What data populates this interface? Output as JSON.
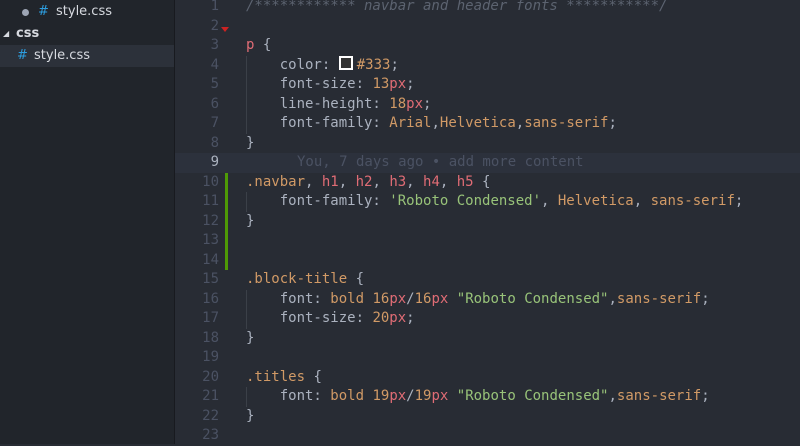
{
  "sidebar": {
    "open_file": "style.css",
    "folder": "css",
    "folder_file": "style.css",
    "hash": "#"
  },
  "editor": {
    "blame": "You, 7 days ago • add more content",
    "lines": [
      {
        "n": "1",
        "tokens": [
          [
            "c-comment",
            "/************ navbar and header fonts ***********/"
          ]
        ]
      },
      {
        "n": "2",
        "tokens": []
      },
      {
        "n": "3",
        "tokens": [
          [
            "c-tag",
            "p"
          ],
          [
            "c-punc",
            " {"
          ]
        ]
      },
      {
        "n": "4",
        "tokens": [
          [
            "c-prop",
            "    color: "
          ],
          [
            "swatch",
            ""
          ],
          [
            "c-num",
            "#333"
          ],
          [
            "c-punc",
            ";"
          ]
        ]
      },
      {
        "n": "5",
        "tokens": [
          [
            "c-prop",
            "    font-size: "
          ],
          [
            "c-num",
            "13"
          ],
          [
            "c-unit",
            "px"
          ],
          [
            "c-punc",
            ";"
          ]
        ]
      },
      {
        "n": "6",
        "tokens": [
          [
            "c-prop",
            "    line-height: "
          ],
          [
            "c-num",
            "18"
          ],
          [
            "c-unit",
            "px"
          ],
          [
            "c-punc",
            ";"
          ]
        ]
      },
      {
        "n": "7",
        "tokens": [
          [
            "c-prop",
            "    font-family: "
          ],
          [
            "c-val",
            "Arial"
          ],
          [
            "c-punc",
            ","
          ],
          [
            "c-val",
            "Helvetica"
          ],
          [
            "c-punc",
            ","
          ],
          [
            "c-val",
            "sans-serif"
          ],
          [
            "c-punc",
            ";"
          ]
        ]
      },
      {
        "n": "8",
        "tokens": [
          [
            "c-punc",
            "}"
          ]
        ]
      },
      {
        "n": "9",
        "tokens": []
      },
      {
        "n": "10",
        "tokens": [
          [
            "c-sel",
            ".navbar"
          ],
          [
            "c-punc",
            ", "
          ],
          [
            "c-tag",
            "h1"
          ],
          [
            "c-punc",
            ", "
          ],
          [
            "c-tag",
            "h2"
          ],
          [
            "c-punc",
            ", "
          ],
          [
            "c-tag",
            "h3"
          ],
          [
            "c-punc",
            ", "
          ],
          [
            "c-tag",
            "h4"
          ],
          [
            "c-punc",
            ", "
          ],
          [
            "c-tag",
            "h5"
          ],
          [
            "c-punc",
            " {"
          ]
        ]
      },
      {
        "n": "11",
        "tokens": [
          [
            "c-prop",
            "    font-family: "
          ],
          [
            "c-str",
            "'Roboto Condensed'"
          ],
          [
            "c-punc",
            ", "
          ],
          [
            "c-val",
            "Helvetica"
          ],
          [
            "c-punc",
            ", "
          ],
          [
            "c-val",
            "sans-serif"
          ],
          [
            "c-punc",
            ";"
          ]
        ]
      },
      {
        "n": "12",
        "tokens": [
          [
            "c-punc",
            "}"
          ]
        ]
      },
      {
        "n": "13",
        "tokens": []
      },
      {
        "n": "14",
        "tokens": []
      },
      {
        "n": "15",
        "tokens": [
          [
            "c-sel",
            ".block-title"
          ],
          [
            "c-punc",
            " {"
          ]
        ]
      },
      {
        "n": "16",
        "tokens": [
          [
            "c-prop",
            "    font: "
          ],
          [
            "c-val",
            "bold "
          ],
          [
            "c-num",
            "16"
          ],
          [
            "c-unit",
            "px"
          ],
          [
            "c-punc",
            "/"
          ],
          [
            "c-num",
            "16"
          ],
          [
            "c-unit",
            "px"
          ],
          [
            "c-punc",
            " "
          ],
          [
            "c-str",
            "\"Roboto Condensed\""
          ],
          [
            "c-punc",
            ","
          ],
          [
            "c-val",
            "sans-serif"
          ],
          [
            "c-punc",
            ";"
          ]
        ]
      },
      {
        "n": "17",
        "tokens": [
          [
            "c-prop",
            "    font-size: "
          ],
          [
            "c-num",
            "20"
          ],
          [
            "c-unit",
            "px"
          ],
          [
            "c-punc",
            ";"
          ]
        ]
      },
      {
        "n": "18",
        "tokens": [
          [
            "c-punc",
            "}"
          ]
        ]
      },
      {
        "n": "19",
        "tokens": []
      },
      {
        "n": "20",
        "tokens": [
          [
            "c-sel",
            ".titles"
          ],
          [
            "c-punc",
            " {"
          ]
        ]
      },
      {
        "n": "21",
        "tokens": [
          [
            "c-prop",
            "    font: "
          ],
          [
            "c-val",
            "bold "
          ],
          [
            "c-num",
            "19"
          ],
          [
            "c-unit",
            "px"
          ],
          [
            "c-punc",
            "/"
          ],
          [
            "c-num",
            "19"
          ],
          [
            "c-unit",
            "px"
          ],
          [
            "c-punc",
            " "
          ],
          [
            "c-str",
            "\"Roboto Condensed\""
          ],
          [
            "c-punc",
            ","
          ],
          [
            "c-val",
            "sans-serif"
          ],
          [
            "c-punc",
            ";"
          ]
        ]
      },
      {
        "n": "22",
        "tokens": [
          [
            "c-punc",
            "}"
          ]
        ]
      },
      {
        "n": "23",
        "tokens": []
      }
    ]
  }
}
